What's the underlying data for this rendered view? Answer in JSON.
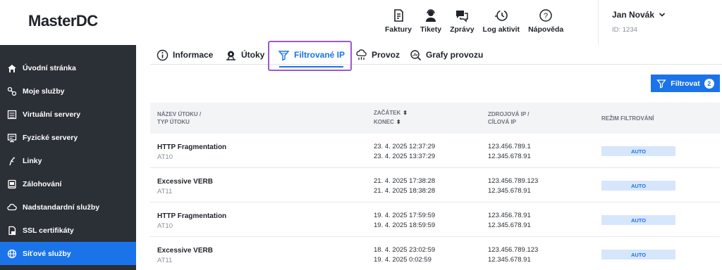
{
  "header": {
    "logo": "MasterDC",
    "nav": [
      {
        "label": "Faktury",
        "icon": "invoice-icon"
      },
      {
        "label": "Tikety",
        "icon": "support-agent-icon"
      },
      {
        "label": "Zprávy",
        "icon": "messages-icon"
      },
      {
        "label": "Log aktivit",
        "icon": "activity-log-icon"
      },
      {
        "label": "Nápověda",
        "icon": "help-icon"
      }
    ],
    "user": {
      "name": "Jan Novák",
      "id": "ID: 1234"
    }
  },
  "sidebar": {
    "items": [
      {
        "label": "Úvodní stránka",
        "icon": "home-icon"
      },
      {
        "label": "Moje služby",
        "icon": "services-icon"
      },
      {
        "label": "Virtuální servery",
        "icon": "virtual-server-icon"
      },
      {
        "label": "Fyzické servery",
        "icon": "physical-server-icon"
      },
      {
        "label": "Linky",
        "icon": "links-icon"
      },
      {
        "label": "Zálohování",
        "icon": "backup-icon"
      },
      {
        "label": "Nadstandardní služby",
        "icon": "cloud-icon"
      },
      {
        "label": "SSL certifikáty",
        "icon": "ssl-icon"
      },
      {
        "label": "Síťové služby",
        "icon": "network-globe-icon",
        "active": true
      }
    ]
  },
  "tabs": [
    {
      "label": "Informace",
      "icon": "info-icon"
    },
    {
      "label": "Útoky",
      "icon": "attacks-icon"
    },
    {
      "label": "Filtrované IP",
      "icon": "filter-funnel-icon",
      "active": true
    },
    {
      "label": "Provoz",
      "icon": "traffic-icon"
    },
    {
      "label": "Grafy provozu",
      "icon": "graphs-icon"
    }
  ],
  "filter_button": {
    "label": "Filtrovat",
    "count": "2"
  },
  "table": {
    "headers": {
      "attack_line1": "NÁZEV ÚTOKU /",
      "attack_line2": "TYP ÚTOKU",
      "start": "ZAČÁTEK",
      "end": "KONEC",
      "ip_line1": "ZDROJOVÁ IP /",
      "ip_line2": "CÍLOVÁ IP",
      "mode": "REŽIM FILTROVÁNÍ"
    },
    "rows": [
      {
        "name": "HTTP Fragmentation",
        "type": "AT10",
        "start": "23. 4. 2025 12:37:29",
        "end": "23. 4. 2025 13:37:29",
        "source_ip": "123.456.789.1",
        "target_ip": "12.345.678.91",
        "mode": "AUTO"
      },
      {
        "name": "Excessive VERB",
        "type": "AT11",
        "start": "21. 4. 2025 17:38:28",
        "end": "21. 4. 2025 18:38:28",
        "source_ip": "123.456.789.123",
        "target_ip": "12.345.678.91",
        "mode": "AUTO"
      },
      {
        "name": "HTTP Fragmentation",
        "type": "AT10",
        "start": "19. 4. 2025 17:59:59",
        "end": "19. 4. 2025 18:59:59",
        "source_ip": "123.456.78.91",
        "target_ip": "12.345.678.91",
        "mode": "AUTO"
      },
      {
        "name": "Excessive VERB",
        "type": "AT11",
        "start": "18. 4. 2025 23:02:59",
        "end": "19. 4. 2025 0:02:59",
        "source_ip": "123.456.789.123",
        "target_ip": "12.345.678.91",
        "mode": "AUTO"
      }
    ]
  },
  "colors": {
    "accent": "#1a73e8",
    "sidebar_bg": "#2b2f36",
    "highlight": "#9b59d0",
    "mode_badge_bg": "#d6e6fb"
  }
}
